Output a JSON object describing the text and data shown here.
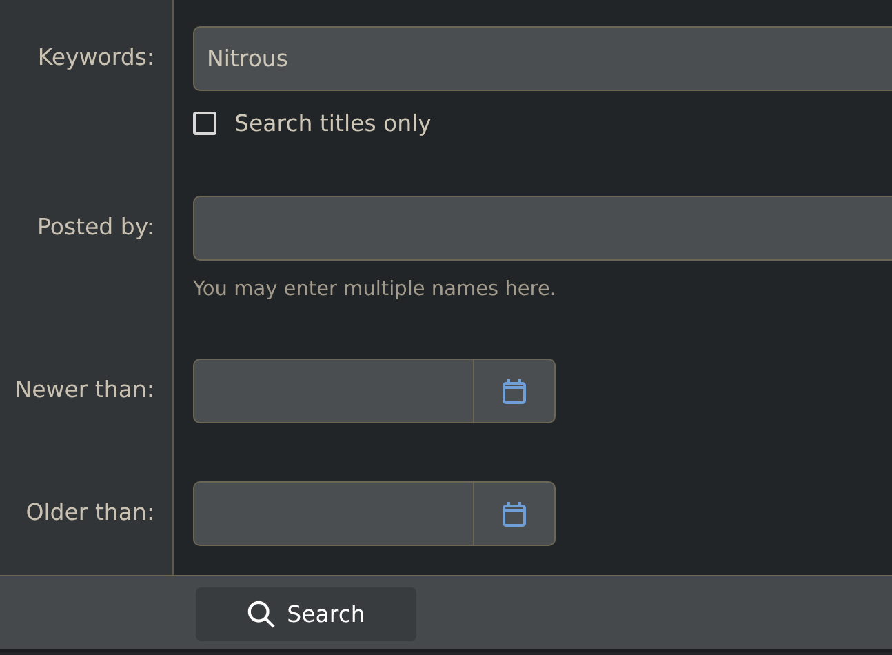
{
  "fields": [
    {
      "kind": "text",
      "label": "Keywords:",
      "value": "Nitrous",
      "checkbox": {
        "label": "Search titles only",
        "checked": false
      }
    },
    {
      "kind": "text",
      "label": "Posted by:",
      "hint": "You may enter multiple names here."
    },
    {
      "kind": "date",
      "label": "Newer than:"
    },
    {
      "kind": "date",
      "label": "Older than:"
    }
  ],
  "submit": {
    "label": "Search"
  }
}
